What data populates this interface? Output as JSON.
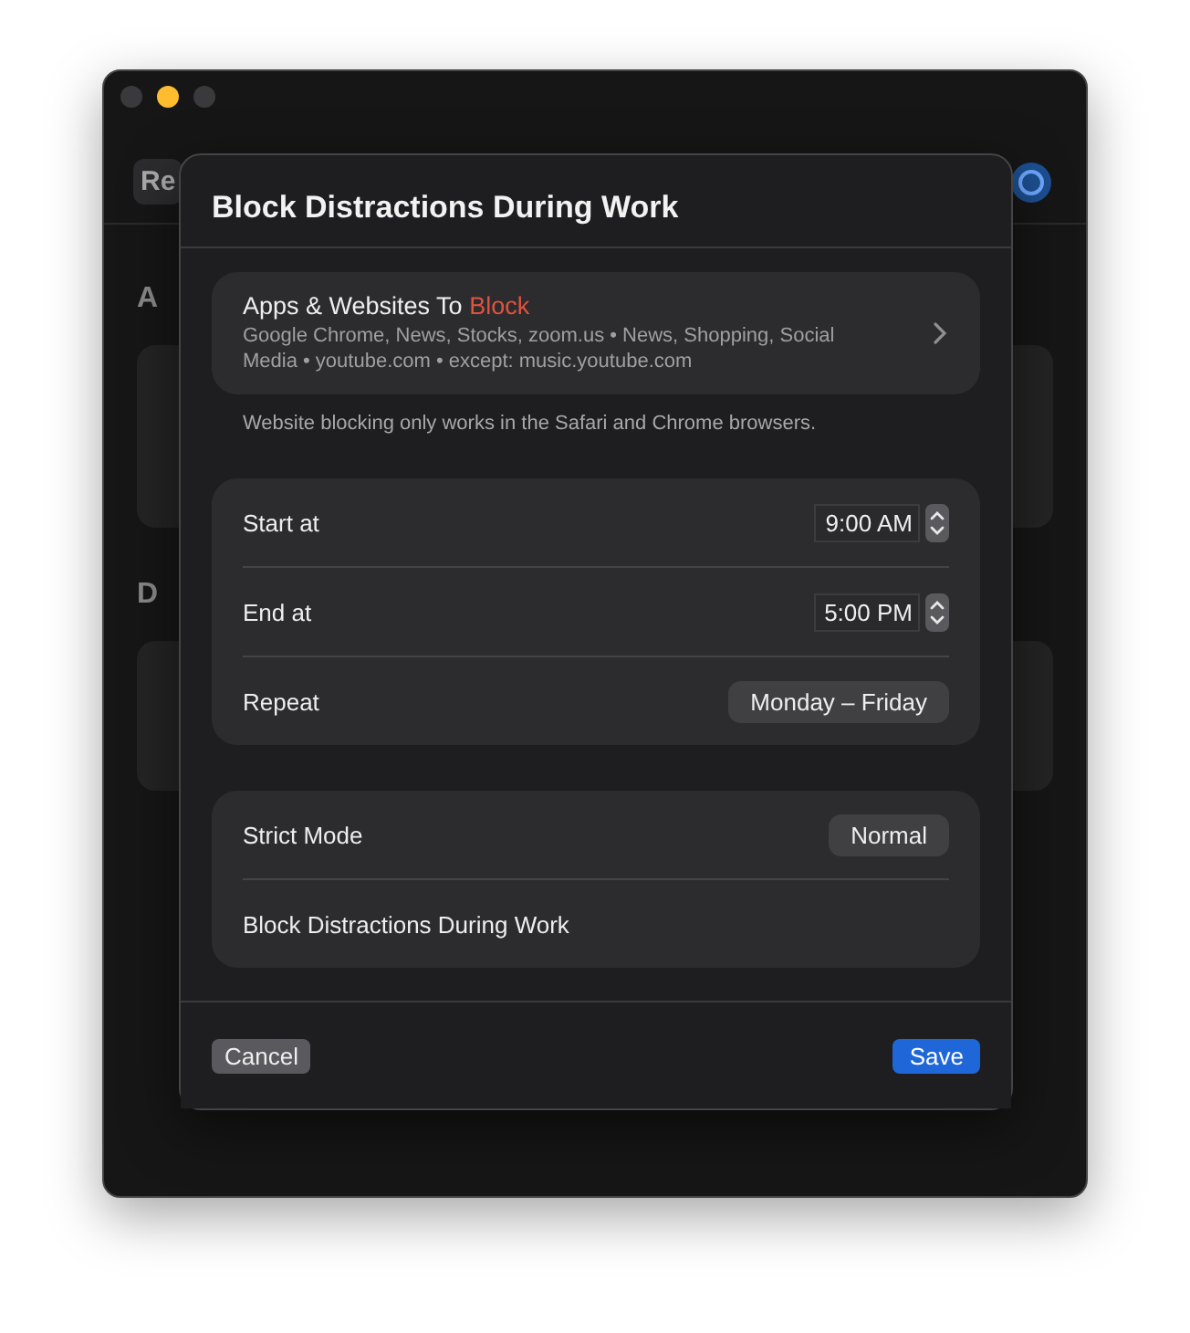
{
  "window": {
    "toolbar_button": "Re",
    "sections": [
      {
        "heading": "A"
      },
      {
        "heading": "D"
      }
    ]
  },
  "dialog": {
    "title": "Block Distractions During Work",
    "block_list": {
      "label": "Apps & Websites To",
      "highlight": "Block",
      "summary": "Google Chrome, News, Stocks, zoom.us • News, Shopping, Social Media • youtube.com • except: music.youtube.com"
    },
    "note": "Website blocking only works in the Safari and Chrome browsers.",
    "schedule": [
      {
        "kind": "time",
        "label": "Start at",
        "value": "9:00 AM"
      },
      {
        "kind": "time",
        "label": "End at",
        "value": "5:00 PM"
      },
      {
        "kind": "popup",
        "label": "Repeat",
        "value": "Monday – Friday"
      }
    ],
    "strict": [
      {
        "kind": "popup",
        "label": "Strict Mode",
        "value": "Normal"
      },
      {
        "kind": "text",
        "label": "Block Distractions During Work"
      }
    ],
    "buttons": {
      "cancel": "Cancel",
      "save": "Save"
    }
  }
}
